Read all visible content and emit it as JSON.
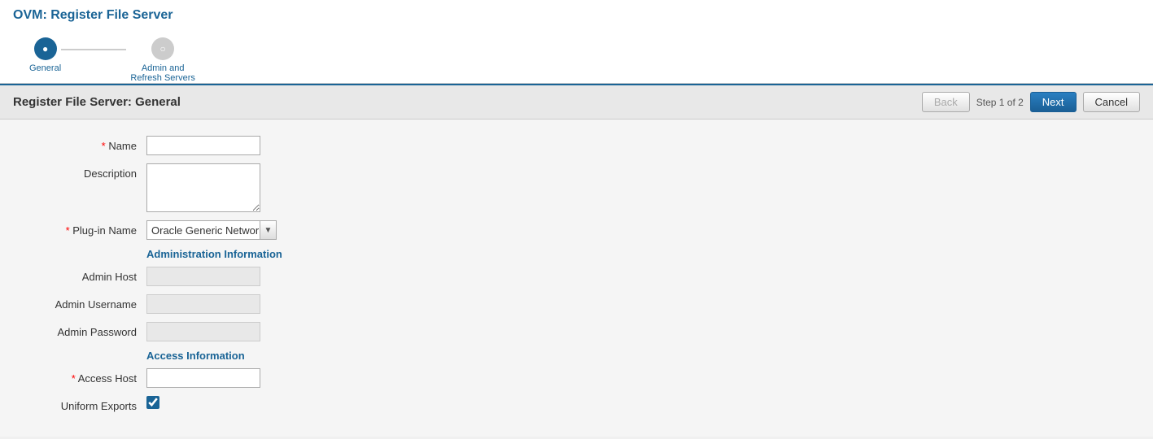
{
  "page": {
    "title": "OVM: Register File Server"
  },
  "wizard": {
    "steps": [
      {
        "id": "general",
        "label": "General",
        "state": "active"
      },
      {
        "id": "admin-refresh",
        "label": "Admin and Refresh Servers",
        "state": "inactive"
      }
    ],
    "connector_label": ""
  },
  "section": {
    "title": "Register File Server: General",
    "step_info": "Step 1 of 2",
    "back_label": "Back",
    "next_label": "Next",
    "cancel_label": "Cancel"
  },
  "form": {
    "name_label": "Name",
    "description_label": "Description",
    "plugin_name_label": "Plug-in Name",
    "plugin_name_value": "Oracle Generic Network Fi",
    "admin_info_label": "Administration Information",
    "admin_host_label": "Admin Host",
    "admin_username_label": "Admin Username",
    "admin_password_label": "Admin Password",
    "access_info_label": "Access Information",
    "access_host_label": "Access Host",
    "uniform_exports_label": "Uniform Exports",
    "name_value": "",
    "description_value": "",
    "admin_host_value": "",
    "admin_username_value": "",
    "admin_password_value": "",
    "access_host_value": "",
    "uniform_exports_checked": true
  }
}
